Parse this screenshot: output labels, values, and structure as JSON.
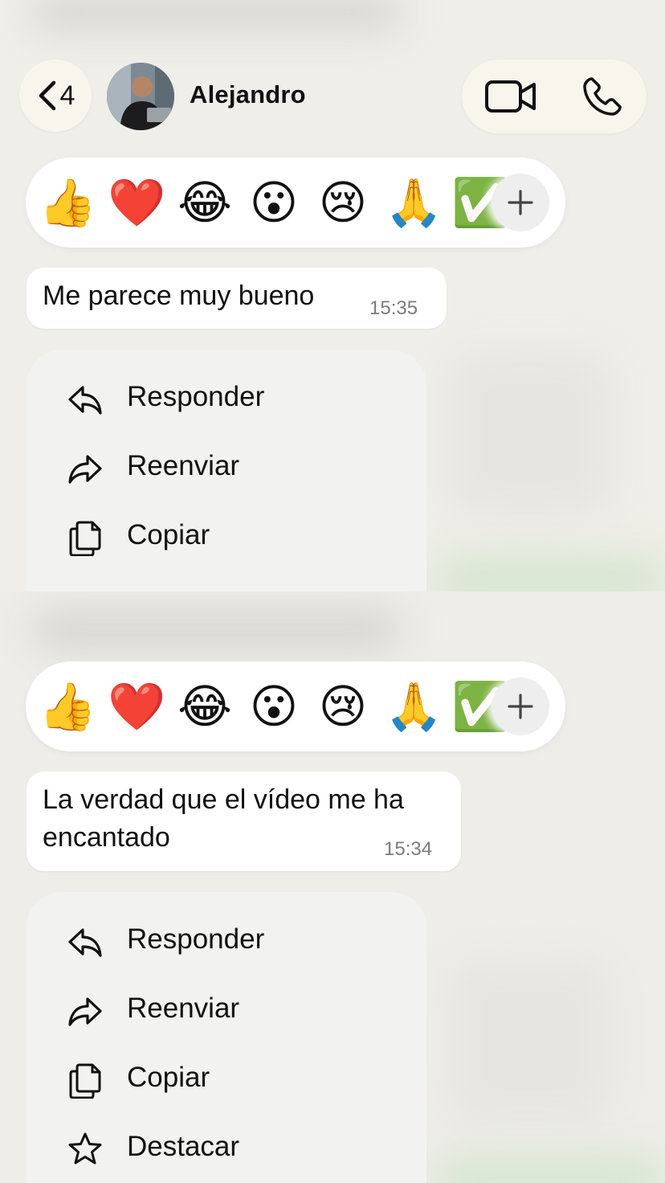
{
  "contact": {
    "back_count": "4",
    "name": "Alejandro"
  },
  "reactions": {
    "emojis": [
      "👍",
      "❤️",
      "😂",
      "😮",
      "😢",
      "🙏",
      "✅"
    ],
    "add_label": "+"
  },
  "messages": [
    {
      "text": "Me parece muy bueno",
      "time": "15:35"
    },
    {
      "text_line1": "La verdad que el vídeo me ha",
      "text_line2": "encantado",
      "time": "15:34"
    }
  ],
  "menu": {
    "reply": "Responder",
    "forward": "Reenviar",
    "copy": "Copiar",
    "star": "Destacar"
  },
  "icons": {
    "back": "chevron-left-icon",
    "video": "video-camera-icon",
    "phone": "phone-icon",
    "reply": "reply-arrow-icon",
    "forward": "forward-arrow-icon",
    "copy": "copy-icon",
    "star": "star-icon",
    "add": "plus-icon"
  }
}
